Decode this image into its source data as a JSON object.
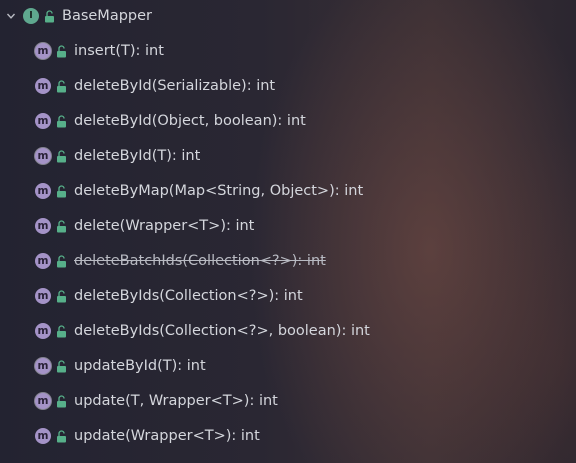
{
  "tree": {
    "root": {
      "label": "BaseMapper",
      "badge": "I",
      "expanded": true
    },
    "methods": [
      {
        "label": "insert(T): int",
        "badge": "m",
        "deprecated": false
      },
      {
        "label": "deleteById(Serializable): int",
        "badge": "m",
        "deprecated": false
      },
      {
        "label": "deleteById(Object, boolean): int",
        "badge": "m",
        "deprecated": false
      },
      {
        "label": "deleteById(T): int",
        "badge": "m",
        "deprecated": false
      },
      {
        "label": "deleteByMap(Map<String, Object>): int",
        "badge": "m",
        "deprecated": false
      },
      {
        "label": "delete(Wrapper<T>): int",
        "badge": "m",
        "deprecated": false
      },
      {
        "label": "deleteBatchIds(Collection<?>): int",
        "badge": "m",
        "deprecated": true
      },
      {
        "label": "deleteByIds(Collection<?>): int",
        "badge": "m",
        "deprecated": false
      },
      {
        "label": "deleteByIds(Collection<?>, boolean): int",
        "badge": "m",
        "deprecated": false
      },
      {
        "label": "updateById(T): int",
        "badge": "m",
        "deprecated": false
      },
      {
        "label": "update(T, Wrapper<T>): int",
        "badge": "m",
        "deprecated": false
      },
      {
        "label": "update(Wrapper<T>): int",
        "badge": "m",
        "deprecated": false
      }
    ]
  },
  "colors": {
    "interface_badge": "#5fa88f",
    "method_badge": "#a493c7",
    "lock_icon": "#57b08a",
    "text": "#d4d6dc"
  }
}
